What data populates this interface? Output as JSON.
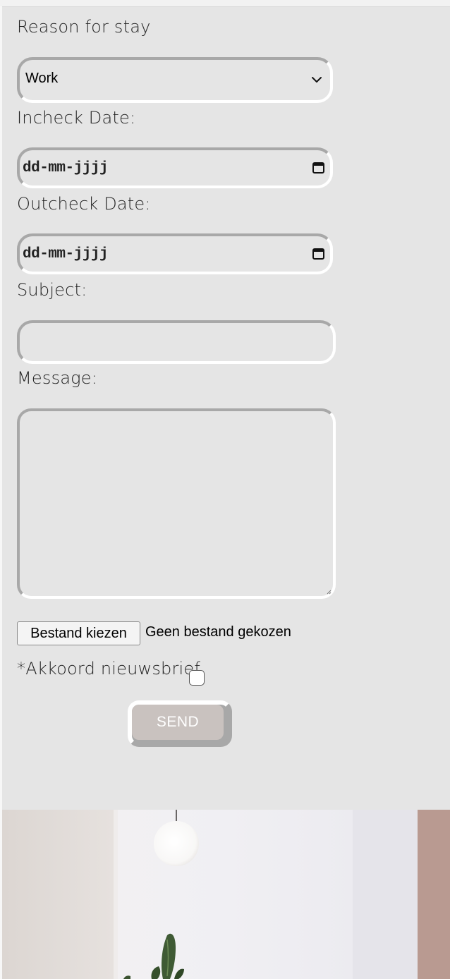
{
  "form": {
    "reason_label": "Reason for stay",
    "reason_value": "Work",
    "incheck_label": "Incheck Date:",
    "incheck_placeholder": "dd-mm-jjjj",
    "outcheck_label": "Outcheck Date:",
    "outcheck_placeholder": "dd-mm-jjjj",
    "subject_label": "Subject:",
    "subject_value": "",
    "message_label": "Message:",
    "message_value": "",
    "file_button_label": "Bestand kiezen",
    "file_status": "Geen bestand gekozen",
    "newsletter_label": "*Akkoord nieuwsbrief",
    "newsletter_checked": false,
    "send_label": "SEND"
  },
  "icons": {
    "select_chevron": "chevron-down-icon",
    "calendar": "calendar-icon"
  },
  "colors": {
    "form_background": "#e5e5e5",
    "field_dark_border": "#a8a8a8",
    "field_light_border": "#ffffff",
    "send_button": "#c9c2bf"
  }
}
